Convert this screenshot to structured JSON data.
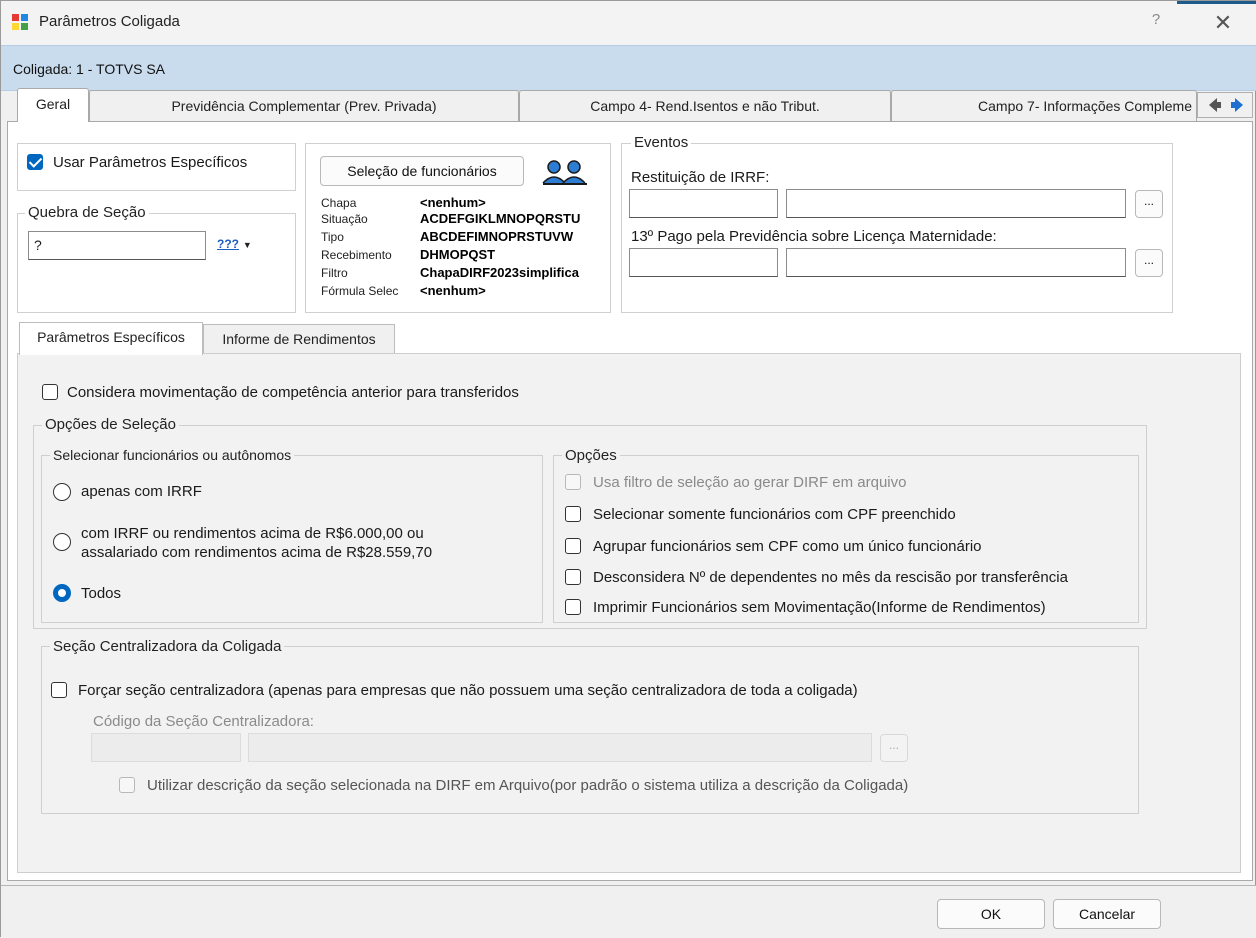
{
  "window": {
    "title": "Parâmetros Coligada",
    "help": "?",
    "close": "✕"
  },
  "coligada": "Coligada: 1 - TOTVS SA",
  "tabs": [
    {
      "label": "Geral"
    },
    {
      "label": "Previdência Complementar (Prev. Privada)"
    },
    {
      "label": "Campo 4- Rend.Isentos e não Tribut."
    },
    {
      "label": "Campo 7- Informações Compleme"
    }
  ],
  "usar_parametros": {
    "label": "Usar Parâmetros Específicos",
    "checked": true
  },
  "quebra_secao": {
    "title": "Quebra de Seção",
    "value": "?",
    "lookup_icon": "???"
  },
  "selecao": {
    "button": "Seleção de funcionários",
    "rows": [
      {
        "key": "Chapa",
        "value": "<nenhum>"
      },
      {
        "key": "Situação",
        "value": "ACDEFGIKLMNOPQRSTU"
      },
      {
        "key": "Tipo",
        "value": "ABCDEFIMNOPRSTUVW"
      },
      {
        "key": "Recebimento",
        "value": "DHMOPQST"
      },
      {
        "key": "Filtro",
        "value": "ChapaDIRF2023simplifica"
      },
      {
        "key": "Fórmula Selec",
        "value": "<nenhum>"
      }
    ]
  },
  "eventos": {
    "title": "Eventos",
    "restituicao_label": "Restituição de IRRF:",
    "decimo_label": "13º Pago pela Previdência sobre Licença Maternidade:",
    "ellipsis": "..."
  },
  "subtabs": [
    {
      "label": "Parâmetros Específicos"
    },
    {
      "label": "Informe de Rendimentos"
    }
  ],
  "considera": "Considera movimentação de competência anterior para transferidos",
  "opcoes_selecao": {
    "title": "Opções de Seleção",
    "selecionar_title": "Selecionar funcionários ou autônomos",
    "radio_apenas": "apenas com IRRF",
    "radio_com_line1": "com IRRF ou rendimentos acima de R$6.000,00 ou",
    "radio_com_line2": "assalariado com rendimentos acima de R$28.559,70",
    "radio_todos": "Todos",
    "opcoes_title": "Opções",
    "opt_filtro": "Usa filtro de seleção ao gerar DIRF em arquivo",
    "opt_cpf": "Selecionar somente funcionários com CPF preenchido",
    "opt_agrupar": "Agrupar funcionários sem CPF como um único funcionário",
    "opt_desconsidera": "Desconsidera Nº de dependentes no mês da rescisão por transferência",
    "opt_imprimir": "Imprimir Funcionários sem Movimentação(Informe de Rendimentos)"
  },
  "secao_centralizadora": {
    "title": "Seção Centralizadora da Coligada",
    "forcar": "Forçar seção centralizadora  (apenas para empresas que não possuem uma seção centralizadora de toda a coligada)",
    "codigo_label": "Código da Seção Centralizadora:",
    "ellipsis": "...",
    "utilizar": "Utilizar descrição da seção selecionada na DIRF em Arquivo(por padrão o sistema utiliza a descrição da Coligada)"
  },
  "footer": {
    "ok": "OK",
    "cancel": "Cancelar"
  },
  "colors": {
    "accent": "#0067c0",
    "header_bar": "#c9dcee"
  }
}
